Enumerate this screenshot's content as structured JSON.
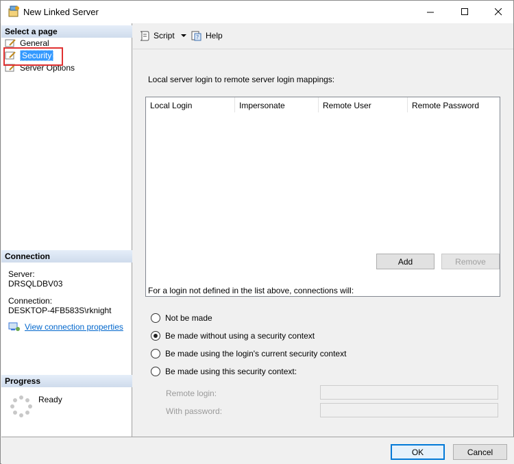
{
  "window": {
    "title": "New Linked Server",
    "minimize_label": "—",
    "maximize_label": "☐",
    "close_label": "✕"
  },
  "left_pane": {
    "select_page_header": "Select a page",
    "pages": [
      {
        "label": "General",
        "icon": "wrench-page-icon"
      },
      {
        "label": "Security",
        "icon": "wrench-page-icon",
        "selected": true
      },
      {
        "label": "Server Options",
        "icon": "wrench-page-icon"
      }
    ],
    "connection_header": "Connection",
    "server_label": "Server:",
    "server_value": "DRSQLDBV03",
    "connection_label": "Connection:",
    "connection_value": "DESKTOP-4FB583S\\rknight",
    "view_connection_link": "View connection properties",
    "progress_header": "Progress",
    "progress_status": "Ready"
  },
  "toolbar": {
    "script_label": "Script",
    "help_label": "Help"
  },
  "content": {
    "mappings_label": "Local server login to remote server login mappings:",
    "grid_columns": [
      "Local Login",
      "Impersonate",
      "Remote User",
      "Remote Password"
    ],
    "grid_rows": [],
    "add_label": "Add",
    "remove_label": "Remove",
    "policy_label": "For a login not defined in the list above, connections will:",
    "options": [
      {
        "label": "Not be made",
        "selected": false
      },
      {
        "label": "Be made without using a security context",
        "selected": true
      },
      {
        "label": "Be made using the login's current security context",
        "selected": false
      },
      {
        "label": "Be made using this security context:",
        "selected": false
      }
    ],
    "remote_login_label": "Remote login:",
    "remote_login_value": "",
    "with_password_label": "With password:",
    "with_password_value": ""
  },
  "footer": {
    "ok_label": "OK",
    "cancel_label": "Cancel"
  },
  "colors": {
    "selection": "#3399ff",
    "link": "#0066cc",
    "highlight_border": "#e03030",
    "default_button_border": "#0078d7"
  }
}
